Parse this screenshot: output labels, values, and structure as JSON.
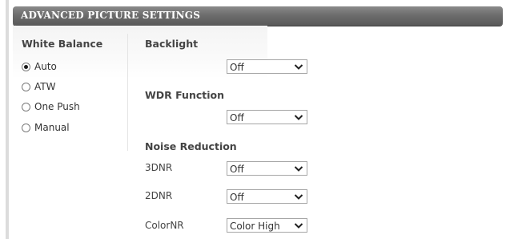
{
  "header": {
    "title": "ADVANCED PICTURE SETTINGS"
  },
  "white_balance": {
    "label": "White Balance",
    "options": [
      {
        "label": "Auto",
        "selected": true
      },
      {
        "label": "ATW",
        "selected": false
      },
      {
        "label": "One Push",
        "selected": false
      },
      {
        "label": "Manual",
        "selected": false
      }
    ]
  },
  "backlight": {
    "label": "Backlight",
    "value": "Off"
  },
  "wdr": {
    "label": "WDR Function",
    "value": "Off"
  },
  "noise_reduction": {
    "label": "Noise Reduction",
    "fields": [
      {
        "label": "3DNR",
        "value": "Off"
      },
      {
        "label": "2DNR",
        "value": "Off"
      },
      {
        "label": "ColorNR",
        "value": "Color High"
      }
    ]
  },
  "icons": {
    "dropdown": "chevron-down-icon"
  }
}
